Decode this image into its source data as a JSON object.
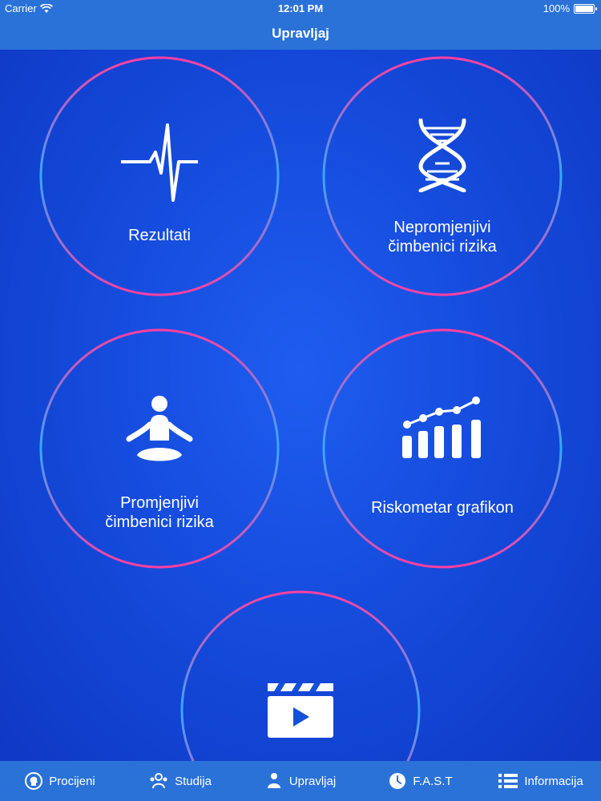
{
  "status_bar": {
    "carrier": "Carrier",
    "time": "12:01 PM",
    "battery": "100%"
  },
  "nav": {
    "title": "Upravljaj"
  },
  "tiles": [
    {
      "label_line1": "Rezultati",
      "label_line2": "",
      "icon": "heartbeat-icon"
    },
    {
      "label_line1": "Nepromjenjivi",
      "label_line2": "čimbenici rizika",
      "icon": "dna-icon"
    },
    {
      "label_line1": "Promjenjivi",
      "label_line2": "čimbenici rizika",
      "icon": "meditation-icon"
    },
    {
      "label_line1": "Riskometar grafikon",
      "label_line2": "",
      "icon": "bar-chart-icon"
    },
    {
      "label_line1": "",
      "label_line2": "",
      "icon": "video-clapper-icon"
    }
  ],
  "tabbar": {
    "items": [
      {
        "label": "Procijeni",
        "icon": "head-icon"
      },
      {
        "label": "Studija",
        "icon": "group-icon"
      },
      {
        "label": "Upravljaj",
        "icon": "person-icon"
      },
      {
        "label": "F.A.S.T",
        "icon": "clock-icon"
      },
      {
        "label": "Informacija",
        "icon": "list-icon"
      }
    ]
  },
  "colors": {
    "bar": "#2a72d8",
    "background": "#1550d8",
    "ring_blue": "#35a8ff",
    "ring_pink": "#ff3fa0"
  }
}
